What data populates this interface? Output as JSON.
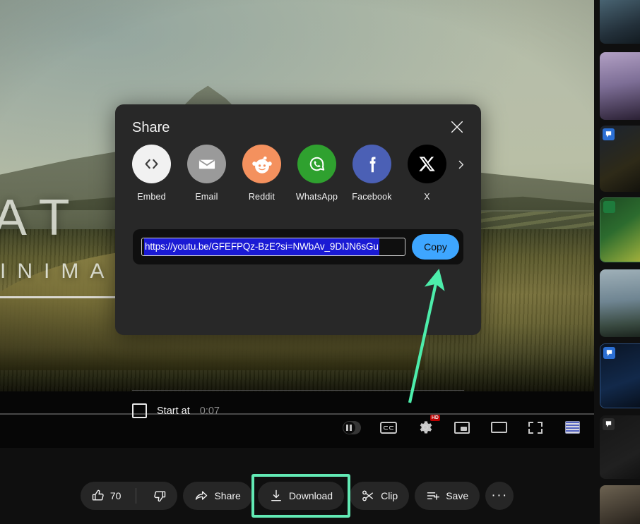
{
  "video": {
    "overlay_title": "AT",
    "overlay_subtitle": "INIMA"
  },
  "player_controls": {
    "autoplay_label": "autoplay-toggle",
    "subtitles_label": "CC",
    "quality_badge": "HD",
    "items": [
      {
        "name": "autoplay-toggle-icon",
        "label": "Autoplay"
      },
      {
        "name": "subtitles-cc-icon",
        "label": "Subtitles/CC"
      },
      {
        "name": "settings-gear-icon",
        "label": "Settings"
      },
      {
        "name": "miniplayer-icon",
        "label": "Miniplayer"
      },
      {
        "name": "theater-mode-icon",
        "label": "Theater mode"
      },
      {
        "name": "fullscreen-icon",
        "label": "Full screen"
      },
      {
        "name": "transcript-cards-icon",
        "label": "Cards"
      }
    ]
  },
  "actions": {
    "like_count": "70",
    "share_label": "Share",
    "download_label": "Download",
    "clip_label": "Clip",
    "save_label": "Save",
    "more_label": "···",
    "download_highlight_color": "#62e9b4"
  },
  "share_dialog": {
    "title": "Share",
    "close_label": "Close",
    "targets": [
      {
        "label": "Embed",
        "icon": "embed-code-icon",
        "bg": "#f1f1f1",
        "fg": "#3c3c3c"
      },
      {
        "label": "Email",
        "icon": "email-icon",
        "bg": "#9a9a9a",
        "fg": "#ffffff"
      },
      {
        "label": "Reddit",
        "icon": "reddit-icon",
        "bg": "#f4915e",
        "fg": "#ffffff"
      },
      {
        "label": "WhatsApp",
        "icon": "whatsapp-icon",
        "bg": "#2fa12f",
        "fg": "#ffffff"
      },
      {
        "label": "Facebook",
        "icon": "facebook-icon",
        "bg": "#4b60b5",
        "fg": "#ffffff"
      },
      {
        "label": "X",
        "icon": "x-twitter-icon",
        "bg": "#000000",
        "fg": "#ffffff"
      }
    ],
    "next_label": "Show more sharing targets",
    "url": "https://youtu.be/GFEFPQz-BzE?si=NWbAv_9DIJN6sGu",
    "copy_label": "Copy",
    "copy_button_color": "#3ea6ff",
    "start_at_label": "Start at",
    "start_at_time": "0:07",
    "start_at_checked": false
  },
  "sidebar": {
    "items": [
      {
        "name": "related-video-1"
      },
      {
        "name": "related-video-2"
      },
      {
        "name": "related-video-3"
      },
      {
        "name": "related-video-4"
      },
      {
        "name": "related-video-5"
      },
      {
        "name": "related-video-6"
      },
      {
        "name": "related-video-7"
      },
      {
        "name": "related-video-8"
      }
    ]
  },
  "annotation": {
    "arrow_color": "#4dedab",
    "arrow_target": "copy-button"
  }
}
